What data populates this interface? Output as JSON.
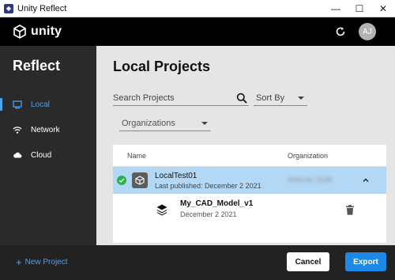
{
  "window": {
    "title": "Unity Reflect",
    "minimize_glyph": "—",
    "maximize_glyph": "☐",
    "close_glyph": "✕"
  },
  "header": {
    "logo_text": "unity",
    "avatar_initials": "AJ",
    "refresh_icon": "refresh-icon"
  },
  "sidebar": {
    "title": "Reflect",
    "items": [
      {
        "label": "Local",
        "icon": "monitor-icon",
        "active": true
      },
      {
        "label": "Network",
        "icon": "wifi-icon",
        "active": false
      },
      {
        "label": "Cloud",
        "icon": "cloud-icon",
        "active": false
      }
    ]
  },
  "main": {
    "title": "Local Projects",
    "search_placeholder": "Search Projects",
    "sort_label": "Sort By",
    "organizations_label": "Organizations",
    "table": {
      "col_name": "Name",
      "col_org": "Organization",
      "project": {
        "name": "LocalTest01",
        "published": "Last published: December 2 2021",
        "organization": "AneLou_Xy3d",
        "status": "synced"
      },
      "model": {
        "name": "My_CAD_Model_v1",
        "date": "December 2 2021"
      }
    }
  },
  "footer": {
    "new_project": "New Project",
    "cancel": "Cancel",
    "export": "Export"
  },
  "colors": {
    "accent": "#4aa3f0",
    "export_button": "#1e88e5",
    "selected_row": "#b3d8f6",
    "success": "#27b24a"
  }
}
